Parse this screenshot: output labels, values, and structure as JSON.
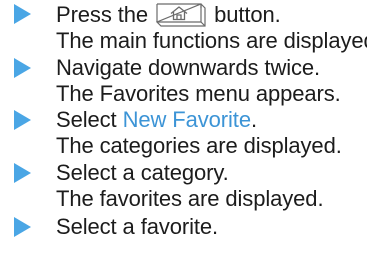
{
  "steps": [
    {
      "instruction_before": "Press the",
      "button_icon": "home-icon",
      "instruction_after": "button.",
      "result": "The main functions are displayed."
    },
    {
      "instruction": "Navigate downwards twice.",
      "result": "The Favorites menu appears."
    },
    {
      "instruction_before": "Select",
      "instruction_highlight": "New Favorite",
      "instruction_after": ".",
      "result": "The categories are displayed."
    },
    {
      "instruction": "Select a category.",
      "result": "The favorites are displayed."
    },
    {
      "instruction": "Select a favorite."
    }
  ],
  "colors": {
    "arrow": "#4aa6e5",
    "highlight_text": "#3c94d6",
    "body_text": "#1c1c1c"
  }
}
